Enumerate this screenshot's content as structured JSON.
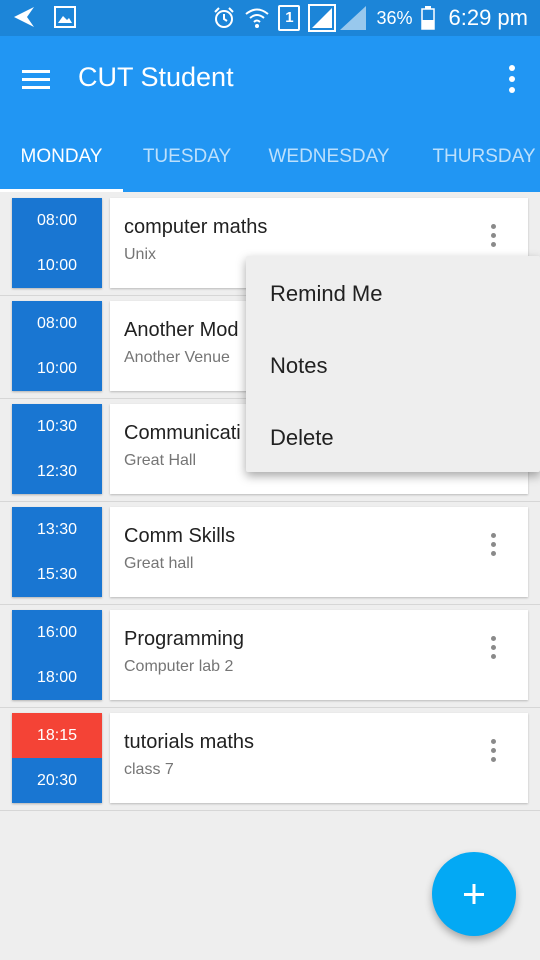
{
  "status_bar": {
    "sim": "1",
    "battery": "36%",
    "time": "6:29 pm",
    "icons": [
      "back-arrow-icon",
      "image-icon",
      "alarm-icon",
      "wifi-icon",
      "signal-icon",
      "battery-icon"
    ]
  },
  "toolbar": {
    "title": "CUT Student",
    "menu_icon": "hamburger-menu-icon",
    "more_icon": "more-vert-icon",
    "color": "#2196f3"
  },
  "tabs": [
    {
      "label": "MONDAY",
      "active": true
    },
    {
      "label": "TUESDAY",
      "active": false
    },
    {
      "label": "WEDNESDAY",
      "active": false
    },
    {
      "label": "THURSDAY",
      "active": false
    }
  ],
  "classes": [
    {
      "start": "08:00",
      "end": "10:00",
      "module": "computer maths",
      "venue": "Unix"
    },
    {
      "start": "08:00",
      "end": "10:00",
      "module": "Another Mod",
      "venue": "Another Venue"
    },
    {
      "start": "10:30",
      "end": "12:30",
      "module": "Communicati",
      "venue": "Great Hall"
    },
    {
      "start": "13:30",
      "end": "15:30",
      "module": "Comm Skills",
      "venue": "Great hall"
    },
    {
      "start": "16:00",
      "end": "18:00",
      "module": "Programming",
      "venue": "Computer lab 2"
    },
    {
      "start": "18:15",
      "end": "20:30",
      "module": "tutorials maths",
      "venue": "class 7"
    }
  ],
  "colors": {
    "time_block": "#1976d2",
    "time_block_current_start": "#f44336",
    "fab": "#03a9f4"
  },
  "popup_menu": {
    "items": [
      "Remind Me",
      "Notes",
      "Delete"
    ]
  },
  "fab": {
    "icon": "add-icon"
  }
}
